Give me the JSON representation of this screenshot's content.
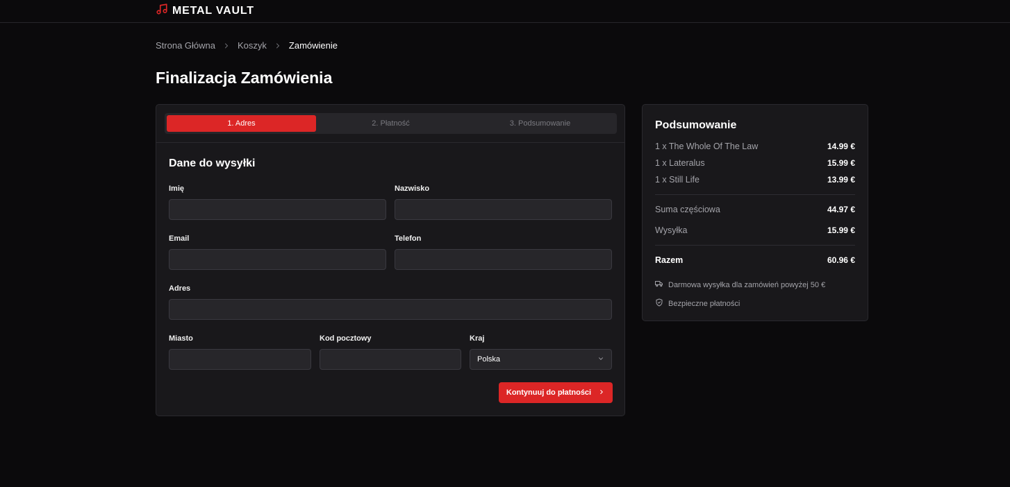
{
  "brand": {
    "name": "METAL VAULT",
    "accent": "#dc2626"
  },
  "breadcrumb": {
    "items": [
      "Strona Główna",
      "Koszyk"
    ],
    "current": "Zamówienie"
  },
  "page": {
    "title": "Finalizacja Zamówienia"
  },
  "steps": [
    {
      "label": "1. Adres",
      "active": true
    },
    {
      "label": "2. Płatność",
      "active": false
    },
    {
      "label": "3. Podsumowanie",
      "active": false
    }
  ],
  "form": {
    "title": "Dane do wysyłki",
    "first_name": {
      "label": "Imię",
      "value": ""
    },
    "last_name": {
      "label": "Nazwisko",
      "value": ""
    },
    "email": {
      "label": "Email",
      "value": ""
    },
    "phone": {
      "label": "Telefon",
      "value": ""
    },
    "address": {
      "label": "Adres",
      "value": ""
    },
    "city": {
      "label": "Miasto",
      "value": ""
    },
    "postal_code": {
      "label": "Kod pocztowy",
      "value": ""
    },
    "country": {
      "label": "Kraj",
      "value": "Polska"
    },
    "continue_label": "Kontynuuj do płatności"
  },
  "summary": {
    "title": "Podsumowanie",
    "items": [
      {
        "name": "1 x The Whole Of The Law",
        "price": "14.99 €"
      },
      {
        "name": "1 x Lateralus",
        "price": "15.99 €"
      },
      {
        "name": "1 x Still Life",
        "price": "13.99 €"
      }
    ],
    "subtotal": {
      "label": "Suma częściowa",
      "value": "44.97 €"
    },
    "shipping": {
      "label": "Wysyłka",
      "value": "15.99 €"
    },
    "total": {
      "label": "Razem",
      "value": "60.96 €"
    },
    "free_shipping_note": "Darmowa wysyłka dla zamówień powyżej 50 €",
    "secure_note": "Bezpieczne płatności"
  }
}
